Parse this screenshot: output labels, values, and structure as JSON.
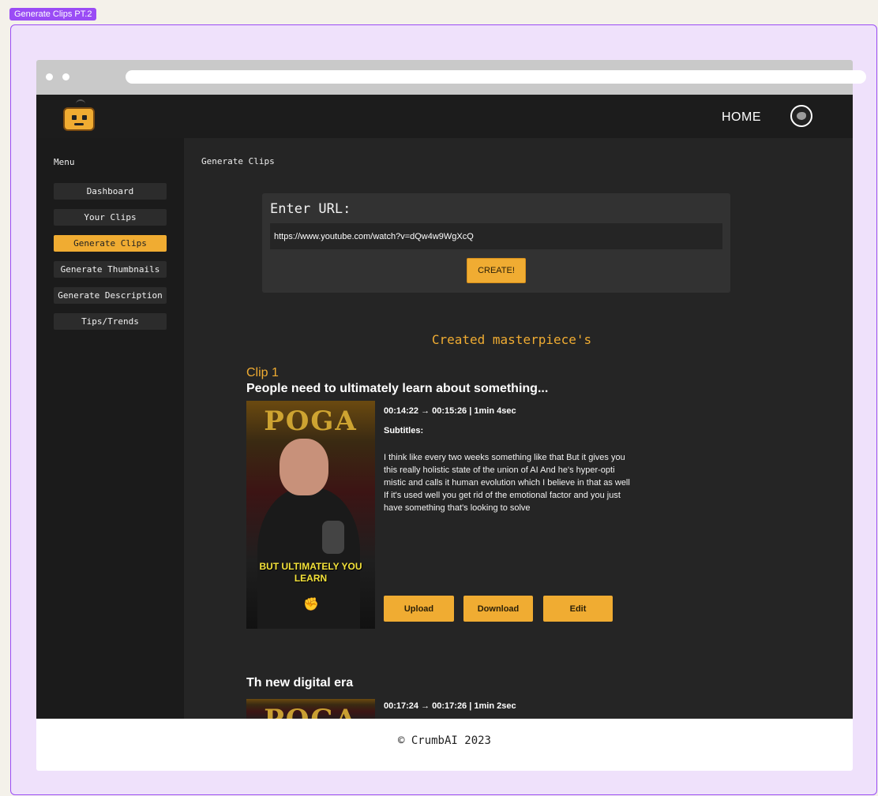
{
  "frame": {
    "tag": "Generate Clips PT.2"
  },
  "header": {
    "home_label": "HOME"
  },
  "sidebar": {
    "title": "Menu",
    "items": [
      {
        "label": "Dashboard",
        "active": false
      },
      {
        "label": "Your Clips",
        "active": false
      },
      {
        "label": "Generate Clips",
        "active": true
      },
      {
        "label": "Generate Thumbnails",
        "active": false
      },
      {
        "label": "Generate Description",
        "active": false
      },
      {
        "label": "Tips/Trends",
        "active": false
      }
    ]
  },
  "main": {
    "breadcrumb": "Generate Clips",
    "url_form": {
      "label": "Enter URL:",
      "value": "https://www.youtube.com/watch?v=dQw4w9WgXcQ",
      "button": "CREATE!"
    },
    "results_title": "Created masterpiece's",
    "clips": [
      {
        "number_label": "Clip 1",
        "title": "People need to ultimately learn about something...",
        "timing": "00:14:22 → 00:15:26 | 1min 4sec",
        "subtitles_label": "Subtitles:",
        "subtitles": "I think like every two weeks something like that But it gives you this really holistic state of the union of AI And he's hyper-opti mistic and calls it human evolution which I believe in that as well If it's used well you get rid of the emotional factor and you just have something that's looking to solve",
        "thumbnail_sign": "POGA",
        "thumbnail_caption": "BUT ULTIMATELY YOU LEARN",
        "buttons": {
          "upload": "Upload",
          "download": "Download",
          "edit": "Edit"
        }
      },
      {
        "title": "Th new digital era",
        "timing": "00:17:24 → 00:17:26 | 1min 2sec",
        "thumbnail_sign": "POGA"
      }
    ]
  },
  "footer": {
    "text": "© CrumbAI 2023"
  },
  "colors": {
    "accent": "#f0ac32",
    "frame": "#9a4cf5",
    "background": "#252525"
  }
}
